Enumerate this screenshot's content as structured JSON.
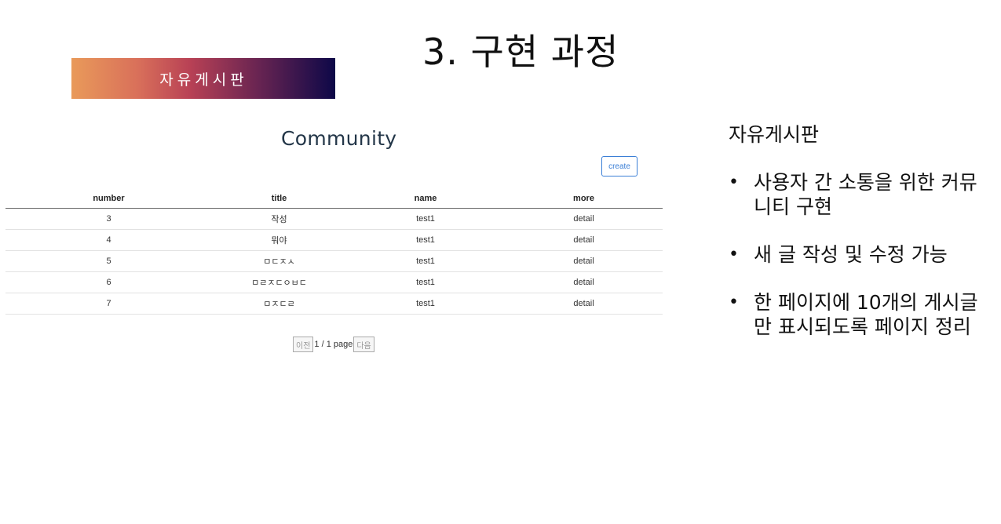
{
  "slide": {
    "title": "3. 구현 과정",
    "banner": "자유게시판"
  },
  "board": {
    "heading": "Community",
    "create_label": "create",
    "columns": [
      "number",
      "title",
      "name",
      "more"
    ],
    "rows": [
      {
        "number": "3",
        "title": "작성",
        "name": "test1",
        "more": "detail"
      },
      {
        "number": "4",
        "title": "뭐야",
        "name": "test1",
        "more": "detail"
      },
      {
        "number": "5",
        "title": "ㅁㄷㅈㅅ",
        "name": "test1",
        "more": "detail"
      },
      {
        "number": "6",
        "title": "ㅁㄹㅈㄷㅇㅂㄷ",
        "name": "test1",
        "more": "detail"
      },
      {
        "number": "7",
        "title": "ㅁㅈㄷㄹ",
        "name": "test1",
        "more": "detail"
      }
    ],
    "pager": {
      "prev_label": "이전",
      "info": "1 / 1 page",
      "next_label": "다음"
    }
  },
  "side": {
    "heading": "자유게시판",
    "bullets": [
      "사용자 간 소통을 위한 커뮤니티 구현",
      "새 글 작성 및 수정 가능",
      "한 페이지에 10개의 게시글만 표시되도록 페이지 정리"
    ]
  },
  "colors": {
    "banner_start": "#e99a5a",
    "banner_end": "#0d0848",
    "create_button": "#3b7fd6"
  }
}
